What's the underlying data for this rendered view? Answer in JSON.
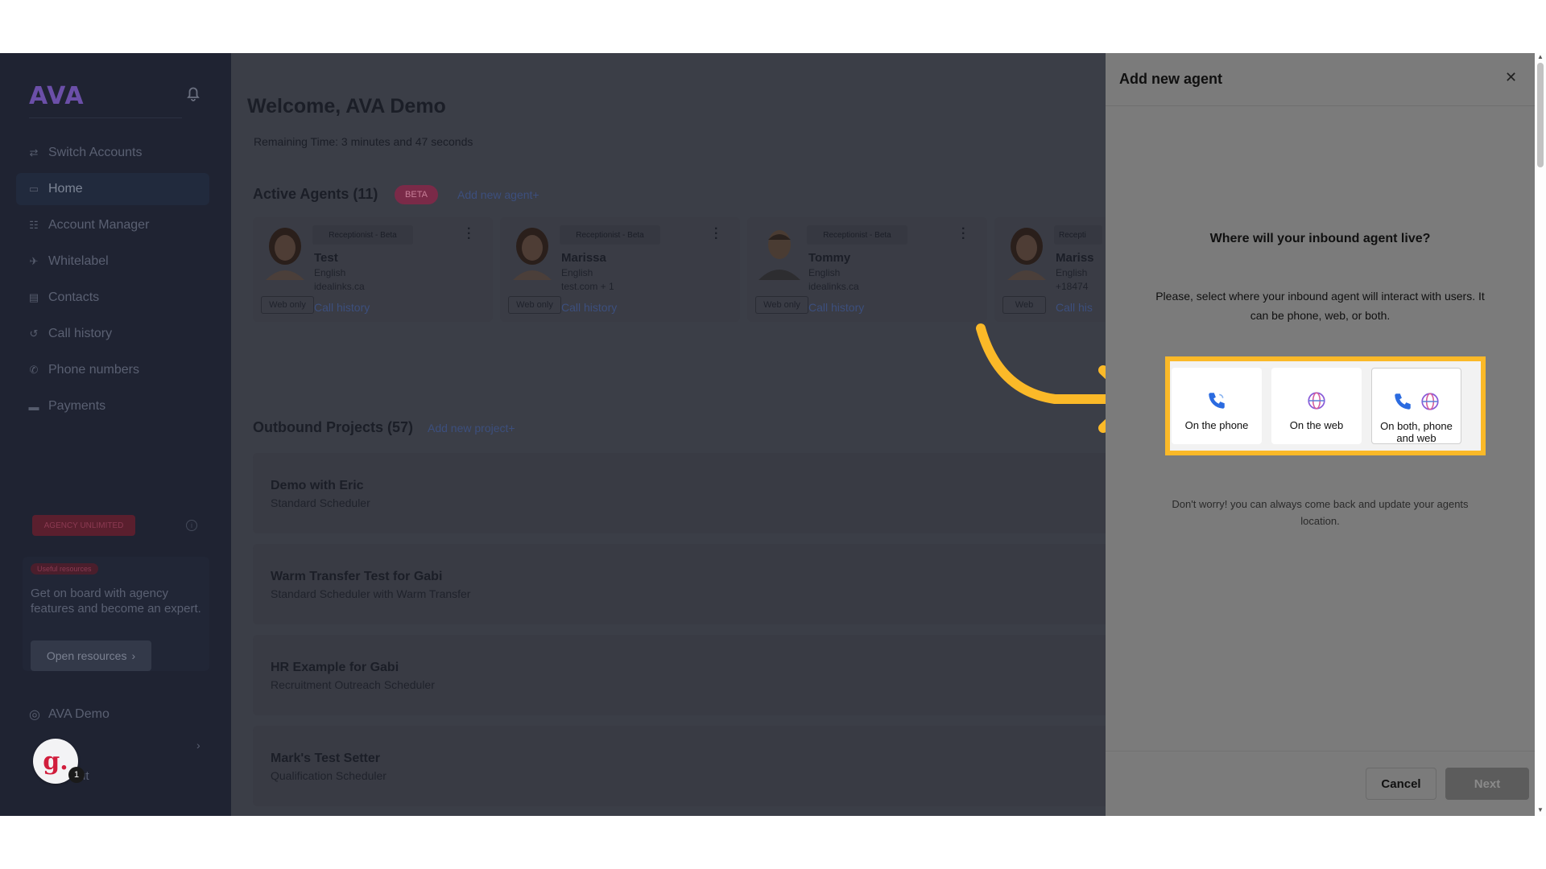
{
  "sidebar": {
    "logo": "AVA",
    "nav": [
      {
        "label": "Switch Accounts",
        "icon": "switch-icon"
      },
      {
        "label": "Home",
        "icon": "folder-icon"
      },
      {
        "label": "Account Manager",
        "icon": "users-icon"
      },
      {
        "label": "Whitelabel",
        "icon": "rocket-icon"
      },
      {
        "label": "Contacts",
        "icon": "contacts-icon"
      },
      {
        "label": "Call history",
        "icon": "history-icon"
      },
      {
        "label": "Phone numbers",
        "icon": "phone-icon"
      },
      {
        "label": "Payments",
        "icon": "card-icon"
      }
    ],
    "active_item": "Home",
    "plan_badge": "AGENCY UNLIMITED",
    "resources": {
      "badge": "Useful resources",
      "text": "Get on board with agency features and become an expert.",
      "button": "Open resources"
    },
    "user_name": "AVA Demo",
    "logout_partial": "ut",
    "avatar_letter": "g.",
    "avatar_count": "1"
  },
  "main": {
    "welcome": "Welcome, AVA Demo",
    "remaining": "Remaining Time: 3 minutes and 47 seconds",
    "active_agents_title": "Active Agents (11)",
    "beta_label": "BETA",
    "add_agent_link": "Add new agent+",
    "agents": [
      {
        "role": "Receptionist - Beta",
        "name": "Test",
        "language": "English",
        "domain": "idealinks.ca",
        "tag": "Web only",
        "call": "Call history"
      },
      {
        "role": "Receptionist - Beta",
        "name": "Marissa",
        "language": "English",
        "domain": "test.com + 1",
        "tag": "Web only",
        "call": "Call history"
      },
      {
        "role": "Receptionist - Beta",
        "name": "Tommy",
        "language": "English",
        "domain": "idealinks.ca",
        "tag": "Web only",
        "call": "Call history"
      },
      {
        "role": "Recepti",
        "name": "Mariss",
        "language": "English",
        "domain": "+18474",
        "tag": "Web",
        "call": "Call his"
      }
    ],
    "outbound_title": "Outbound Projects (57)",
    "add_project_link": "Add new project+",
    "projects": [
      {
        "title": "Demo with Eric",
        "subtitle": "Standard Scheduler"
      },
      {
        "title": "Warm Transfer Test for Gabi",
        "subtitle": "Standard Scheduler with Warm Transfer"
      },
      {
        "title": "HR Example for Gabi",
        "subtitle": "Recruitment Outreach Scheduler"
      },
      {
        "title": "Mark's Test Setter",
        "subtitle": "Qualification Scheduler"
      }
    ]
  },
  "panel": {
    "title": "Add new agent",
    "question": "Where will your inbound agent live?",
    "description": "Please, select where your inbound agent will interact with users. It can be phone, web, or both.",
    "options": [
      {
        "label": "On the phone",
        "icon": "phone-icon"
      },
      {
        "label": "On the web",
        "icon": "globe-icon"
      },
      {
        "label": "On both, phone and web",
        "icon": "phone-globe-icon"
      }
    ],
    "note": "Don't worry! you can always come back and update your agents location.",
    "cancel": "Cancel",
    "next": "Next"
  },
  "colors": {
    "highlight": "#fbb928",
    "sidebar_bg": "#1f2332",
    "phone_icon": "#2b6be0",
    "globe_icon": "#8a5bd8"
  }
}
